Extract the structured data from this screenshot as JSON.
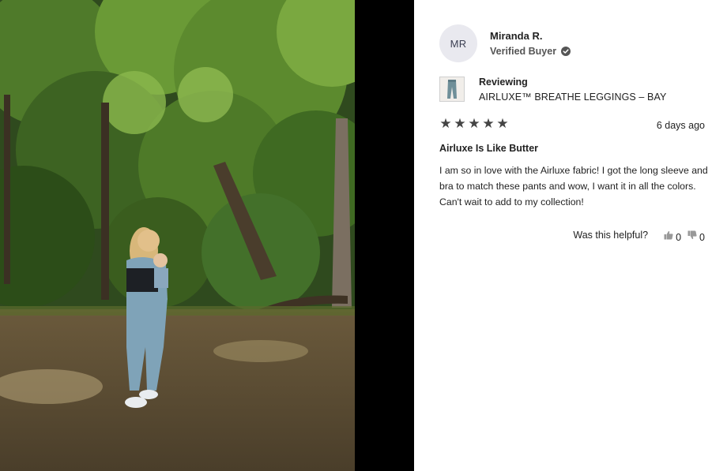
{
  "reviewer": {
    "initials": "MR",
    "name": "Miranda R.",
    "badge": "Verified Buyer"
  },
  "product": {
    "reviewing_label": "Reviewing",
    "name": "AIRLUXE™ BREATHE LEGGINGS – BAY"
  },
  "review": {
    "rating": 5,
    "stars": [
      "★",
      "★",
      "★",
      "★",
      "★"
    ],
    "date": "6 days ago",
    "title": "Airluxe Is Like Butter",
    "body": "I am so in love with the Airluxe fabric! I got the long sleeve and bra to match these pants and wow, I want it in all the colors. Can't wait to add to my collection!"
  },
  "helpful": {
    "question": "Was this helpful?",
    "up_count": "0",
    "down_count": "0"
  },
  "icons": {
    "verified": "check-circle-icon",
    "thumbs_up": "thumbs-up-icon",
    "thumbs_down": "thumbs-down-icon"
  },
  "colors": {
    "panel_bg": "#ffffff",
    "avatar_bg": "#e9e9ef",
    "star": "#444444",
    "outfit": "#7fa3b8"
  }
}
